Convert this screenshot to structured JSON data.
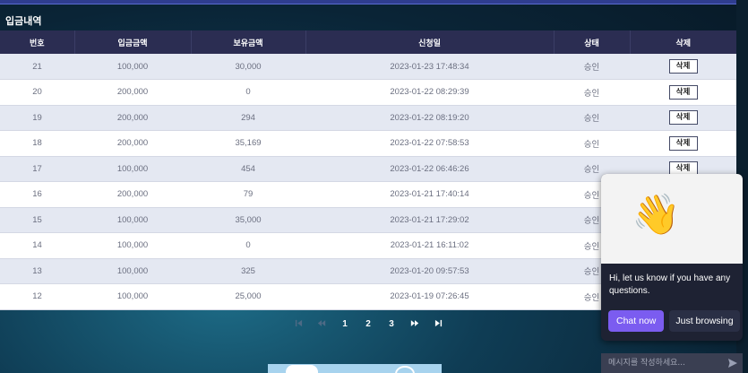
{
  "section": {
    "title": "입금내역"
  },
  "table": {
    "headers": [
      "번호",
      "입금금액",
      "보유금액",
      "신청일",
      "상태",
      "삭제"
    ],
    "rows": [
      [
        "21",
        "100,000",
        "30,000",
        "2023-01-23 17:48:34",
        "승인",
        "삭제"
      ],
      [
        "20",
        "200,000",
        "0",
        "2023-01-22 08:29:39",
        "승인",
        "삭제"
      ],
      [
        "19",
        "200,000",
        "294",
        "2023-01-22 08:19:20",
        "승인",
        "삭제"
      ],
      [
        "18",
        "200,000",
        "35,169",
        "2023-01-22 07:58:53",
        "승인",
        "삭제"
      ],
      [
        "17",
        "100,000",
        "454",
        "2023-01-22 06:46:26",
        "승인",
        "삭제"
      ],
      [
        "16",
        "200,000",
        "79",
        "2023-01-21 17:40:14",
        "승인",
        ""
      ],
      [
        "15",
        "100,000",
        "35,000",
        "2023-01-21 17:29:02",
        "승인",
        ""
      ],
      [
        "14",
        "100,000",
        "0",
        "2023-01-21 16:11:02",
        "승인",
        ""
      ],
      [
        "13",
        "100,000",
        "325",
        "2023-01-20 09:57:53",
        "승인",
        ""
      ],
      [
        "12",
        "100,000",
        "25,000",
        "2023-01-19 07:26:45",
        "승인",
        ""
      ]
    ]
  },
  "pagination": {
    "pages": [
      "1",
      "2",
      "3"
    ],
    "icons": [
      "first-page-icon",
      "prev-page-icon",
      "next-page-icon",
      "last-page-icon"
    ]
  },
  "chat": {
    "hero_icon": "waving-hand-icon",
    "message": "Hi, let us know if you have any questions.",
    "chat_now_label": "Chat now",
    "browse_label": "Just browsing",
    "input_placeholder": "메시지를 작성하세요...",
    "send_icon": "send-icon",
    "accent": "#7b5cf0"
  },
  "colors": {
    "header_bg": "#2b2d52",
    "row_alt": "#e4e8f2",
    "topbar": "#2f3d8f"
  }
}
